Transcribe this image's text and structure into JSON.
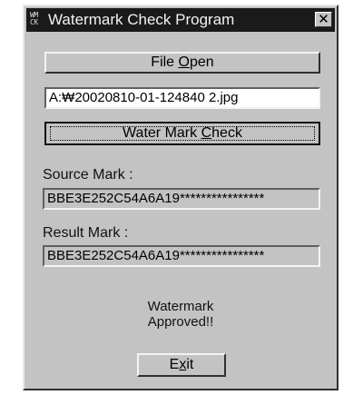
{
  "window": {
    "title": "Watermark Check Program",
    "icon_text": "WM CK"
  },
  "buttons": {
    "file_open": {
      "pre": "File ",
      "accel": "O",
      "post": "pen"
    },
    "water_mark_check": {
      "pre": "Water Mark ",
      "accel": "C",
      "post": "heck"
    },
    "exit": {
      "pre": "E",
      "accel": "x",
      "post": "it"
    }
  },
  "file_path": {
    "value": "A:₩20020810-01-124840 2.jpg"
  },
  "source_mark": {
    "label": "Source Mark :",
    "value": "BBE3E252C54A6A19****************"
  },
  "result_mark": {
    "label": "Result Mark  :",
    "value": "BBE3E252C54A6A19****************"
  },
  "status": {
    "line1": "Watermark",
    "line2": "Approved!!"
  },
  "icons": {
    "app": "watermark-app-icon",
    "close": "close-icon"
  }
}
